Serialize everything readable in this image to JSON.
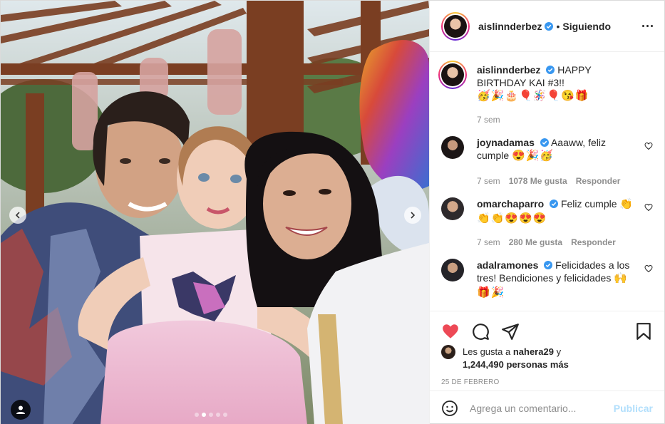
{
  "post": {
    "author": "aislinnderbez",
    "follow_status": "Siguiendo",
    "separator": "•",
    "caption": {
      "text": "HAPPY BIRTHDAY KAI #3!!",
      "emojis": "🥳🎉🎂🎈🪅🎈😘🎁",
      "time": "7 sem"
    },
    "comments": [
      {
        "user": "joynadamas",
        "verified": true,
        "text": "Aaaww, feliz cumple",
        "emojis": "😍🎉🥳",
        "time": "7 sem",
        "likes": "1078 Me gusta",
        "reply": "Responder"
      },
      {
        "user": "omarchaparro",
        "verified": true,
        "text": "Feliz cumple",
        "emojis": "👏",
        "emojis2": "👏👏😍😍😍",
        "time": "7 sem",
        "likes": "280 Me gusta",
        "reply": "Responder"
      },
      {
        "user": "adalramones",
        "verified": true,
        "text": "Felicidades a los tres! Bendiciones y felicidades",
        "emojis": "🙌",
        "emojis2": "🎁🎉"
      }
    ],
    "likes_prefix": "Les gusta a",
    "liked_by": "nahera29",
    "likes_mid": "y",
    "likes_count": "1,244,490 personas más",
    "date": "25 DE FEBRERO",
    "add_comment_placeholder": "Agrega un comentario...",
    "publish_label": "Publicar",
    "carousel": {
      "slides": 5,
      "active": 1
    }
  },
  "colors": {
    "verified": "#3897f0",
    "heart": "#ed4956",
    "publish": "#b2dffc"
  },
  "icons": {
    "like": "heart-icon",
    "comment": "comment-icon",
    "share": "share-icon",
    "save": "bookmark-icon",
    "emoji": "smile-icon",
    "tag": "user-tag-icon"
  }
}
